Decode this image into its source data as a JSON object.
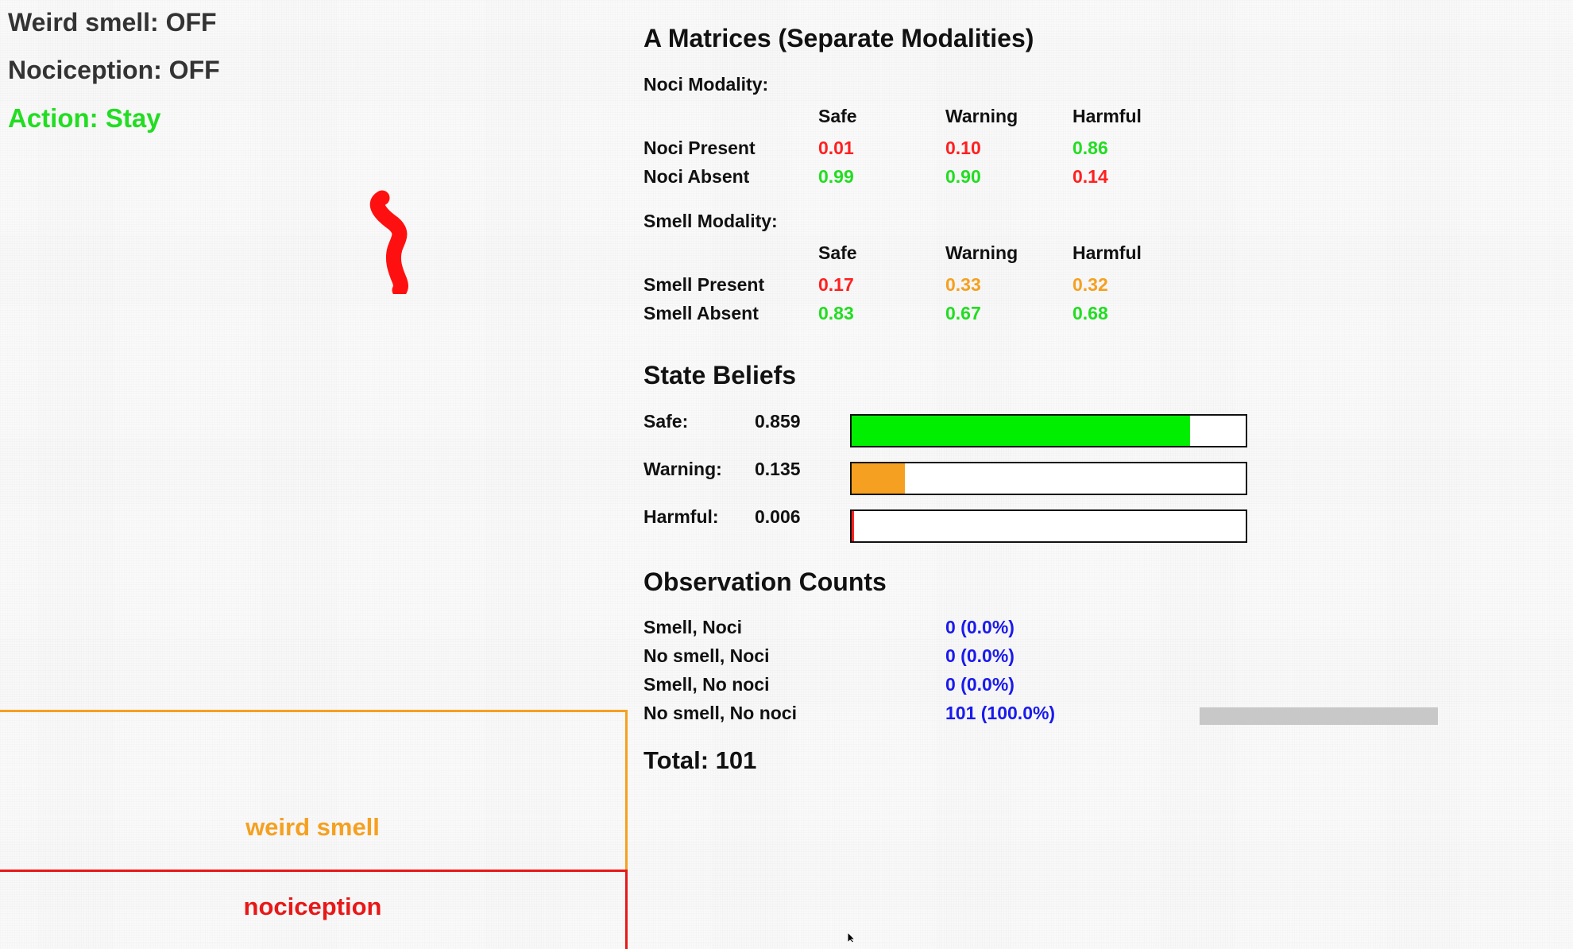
{
  "status": {
    "smell_label": "Weird smell: OFF",
    "noci_label": "Nociception: OFF",
    "action_label": "Action: Stay",
    "action_color": "#22dd22"
  },
  "zones": {
    "smell": {
      "label": "weird smell",
      "color": "#f5a020"
    },
    "noci": {
      "label": "nociception",
      "color": "#e81818"
    }
  },
  "matrices": {
    "title": "A Matrices (Separate Modalities)",
    "columns": [
      "Safe",
      "Warning",
      "Harmful"
    ],
    "noci": {
      "heading": "Noci Modality:",
      "rows": [
        {
          "label": "Noci Present",
          "values": [
            {
              "text": "0.01",
              "color": "#ff2020"
            },
            {
              "text": "0.10",
              "color": "#ff2020"
            },
            {
              "text": "0.86",
              "color": "#22dd22"
            }
          ]
        },
        {
          "label": "Noci Absent",
          "values": [
            {
              "text": "0.99",
              "color": "#22dd22"
            },
            {
              "text": "0.90",
              "color": "#22dd22"
            },
            {
              "text": "0.14",
              "color": "#ff2020"
            }
          ]
        }
      ]
    },
    "smell": {
      "heading": "Smell Modality:",
      "rows": [
        {
          "label": "Smell Present",
          "values": [
            {
              "text": "0.17",
              "color": "#ff2020"
            },
            {
              "text": "0.33",
              "color": "#f5a020"
            },
            {
              "text": "0.32",
              "color": "#f5a020"
            }
          ]
        },
        {
          "label": "Smell Absent",
          "values": [
            {
              "text": "0.83",
              "color": "#22dd22"
            },
            {
              "text": "0.67",
              "color": "#22dd22"
            },
            {
              "text": "0.68",
              "color": "#22dd22"
            }
          ]
        }
      ]
    }
  },
  "beliefs": {
    "title": "State Beliefs",
    "items": [
      {
        "label": "Safe:",
        "value_text": "0.859",
        "value": 0.859,
        "color": "#00ee00"
      },
      {
        "label": "Warning:",
        "value_text": "0.135",
        "value": 0.135,
        "color": "#f5a020"
      },
      {
        "label": "Harmful:",
        "value_text": "0.006",
        "value": 0.006,
        "color": "#ff2020"
      }
    ]
  },
  "observations": {
    "title": "Observation Counts",
    "count_color": "#1a1aee",
    "rows": [
      {
        "label": "Smell, Noci",
        "count": "0 (0.0%)",
        "fraction": 0.0
      },
      {
        "label": "No smell, Noci",
        "count": "0 (0.0%)",
        "fraction": 0.0
      },
      {
        "label": "Smell, No noci",
        "count": "0 (0.0%)",
        "fraction": 0.0
      },
      {
        "label": "No smell, No noci",
        "count": "101 (100.0%)",
        "fraction": 1.0
      }
    ],
    "bar_color": "#c8c8c8",
    "total_label": "Total: 101"
  }
}
